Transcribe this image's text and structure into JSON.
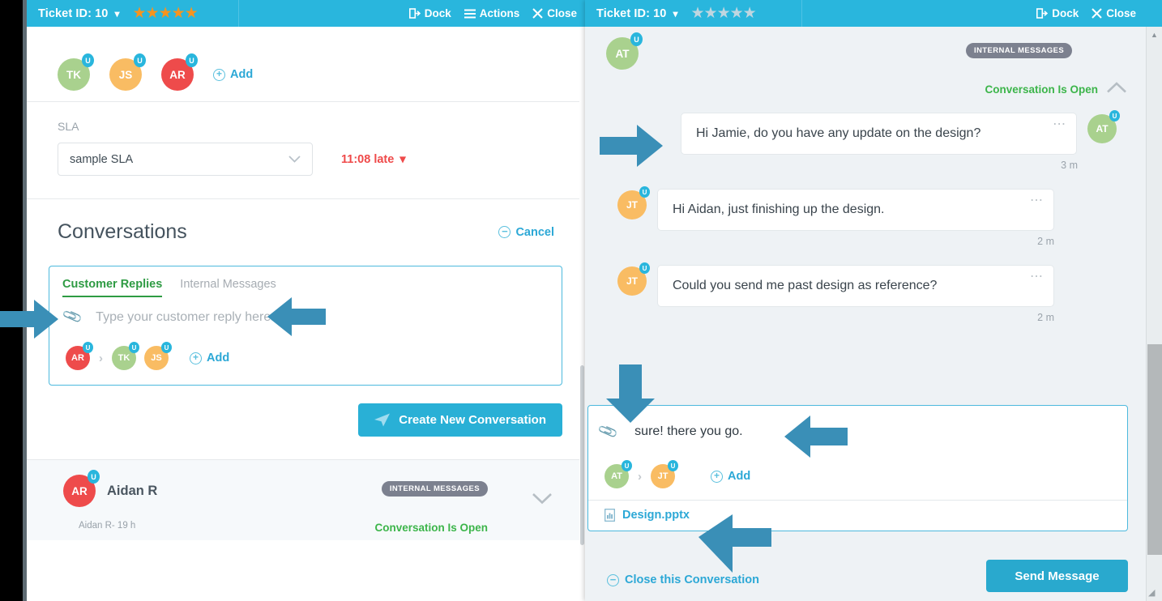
{
  "left_panel": {
    "header": {
      "ticket_label": "Ticket ID: 10",
      "caret": "chevron-down-icon",
      "rating_stars": 5,
      "rating_filled": 5,
      "star_color": "#f7941e",
      "actions": [
        {
          "label": "Dock",
          "icon": "dock-icon"
        },
        {
          "label": "Actions",
          "icon": "hamburger-icon"
        },
        {
          "label": "Close",
          "icon": "close-x-icon"
        }
      ]
    },
    "assignees": [
      {
        "initials": "TK",
        "color": "#a9d18e",
        "badge": "U"
      },
      {
        "initials": "JS",
        "color": "#f9bc63",
        "badge": "U"
      },
      {
        "initials": "AR",
        "color": "#ee4b4b",
        "badge": "U"
      }
    ],
    "add_label": "Add",
    "sla": {
      "label": "SLA",
      "selected": "sample SLA",
      "status": "11:08 late"
    },
    "conversations": {
      "title": "Conversations",
      "cancel_label": "Cancel"
    },
    "composer": {
      "tabs": [
        {
          "label": "Customer Replies",
          "active": true
        },
        {
          "label": "Internal Messages",
          "active": false
        }
      ],
      "placeholder": "Type your customer reply here...",
      "participants": [
        {
          "initials": "AR",
          "color": "#ee4b4b",
          "badge": "U"
        },
        {
          "initials": "TK",
          "color": "#a9d18e",
          "badge": "U"
        },
        {
          "initials": "JS",
          "color": "#f9bc63",
          "badge": "U"
        }
      ],
      "add_label": "Add"
    },
    "create_button": "Create New Conversation",
    "conversation_item": {
      "avatar_initials": "AR",
      "avatar_color": "#ee4b4b",
      "avatar_badge": "U",
      "name": "Aidan R",
      "badge": "INTERNAL MESSAGES",
      "meta": "Aidan R- 19 h",
      "status": "Conversation Is Open",
      "status_color": "#3cb54a"
    }
  },
  "right_panel": {
    "header": {
      "ticket_label": "Ticket ID: 10",
      "caret": "chevron-down-icon",
      "rating_stars": 5,
      "rating_filled": 0,
      "star_color": "#bfd6e0",
      "actions": [
        {
          "label": "Dock",
          "icon": "dock-icon"
        },
        {
          "label": "Close",
          "icon": "close-x-icon"
        }
      ]
    },
    "thread_header": {
      "avatar_initials": "AT",
      "avatar_color": "#a9d18e",
      "avatar_badge": "U",
      "badge": "INTERNAL MESSAGES",
      "status": "Conversation Is Open",
      "status_color": "#3cb54a"
    },
    "messages": [
      {
        "avatar_initials": "AT",
        "avatar_color": "#a9d18e",
        "avatar_badge": "U",
        "text": "Hi Jamie, do you have any update on the design?",
        "time": "3 m",
        "side": "right"
      },
      {
        "avatar_initials": "JT",
        "avatar_color": "#f9bc63",
        "avatar_badge": "U",
        "text": "Hi Aidan, just finishing up the design.",
        "time": "2 m",
        "side": "left"
      },
      {
        "avatar_initials": "JT",
        "avatar_color": "#f9bc63",
        "avatar_badge": "U",
        "text": "Could you send me past design as reference?",
        "time": "2 m",
        "side": "left"
      }
    ],
    "composer": {
      "text": "sure! there you go.",
      "participants": [
        {
          "initials": "AT",
          "color": "#a9d18e",
          "badge": "U"
        },
        {
          "initials": "JT",
          "color": "#f9bc63",
          "badge": "U"
        }
      ],
      "add_label": "Add",
      "attachment": "Design.pptx"
    },
    "close_conversation_label": "Close this Conversation",
    "send_button": "Send Message"
  },
  "theme": {
    "header_blue": "#29b6dd",
    "accent_blue": "#2ca8d6",
    "green": "#2e9b43",
    "red": "#ef4a4a",
    "arrow_blue": "#3a8fb7"
  }
}
